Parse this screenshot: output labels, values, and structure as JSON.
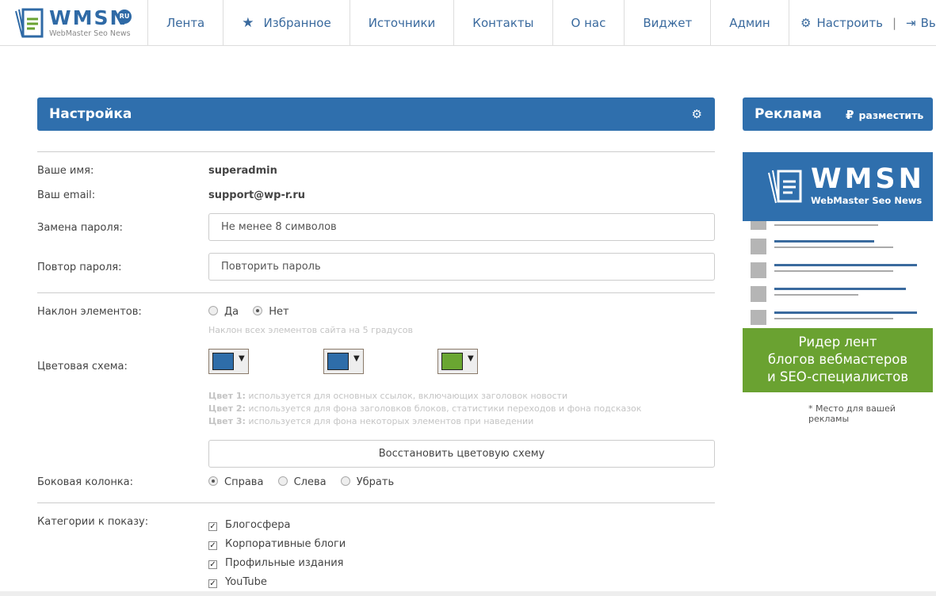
{
  "logo": {
    "text": "WMSN",
    "badge": "RU",
    "subtitle": "WebMaster Seo News"
  },
  "nav": [
    {
      "label": "Лента"
    },
    {
      "label": "Избранное",
      "icon": "star-icon"
    },
    {
      "label": "Источники"
    },
    {
      "label": "Контакты"
    },
    {
      "label": "О нас"
    },
    {
      "label": "Виджет"
    },
    {
      "label": "Админ"
    }
  ],
  "top_right": {
    "settings": "Настроить",
    "separator": "|",
    "logout": "Вы"
  },
  "settings": {
    "title": "Настройка",
    "name_label": "Ваше имя:",
    "name_value": "superadmin",
    "email_label": "Ваш email:",
    "email_value": "support@wp-r.ru",
    "password_label": "Замена пароля:",
    "password_placeholder": "Не менее 8 символов",
    "repeat_label": "Повтор пароля:",
    "repeat_placeholder": "Повторить пароль",
    "tilt_label": "Наклон элементов:",
    "tilt_yes": "Да",
    "tilt_no": "Нет",
    "tilt_selected": "Нет",
    "tilt_hint": "Наклон всех элементов сайта на 5 градусов",
    "color_label": "Цветовая схема:",
    "colors": [
      "#2e6da9",
      "#2e6da9",
      "#6aa631"
    ],
    "color_hints": [
      {
        "k": "Цвет 1:",
        "v": " используется для основных ссылок, включающих заголовок новости"
      },
      {
        "k": "Цвет 2:",
        "v": " используется для фона заголовков блоков, статистики переходов и фона подсказок"
      },
      {
        "k": "Цвет 3:",
        "v": " используется для фона некоторых элементов при наведении"
      }
    ],
    "restore_button": "Восстановить цветовую схему",
    "sidebar_label": "Боковая колонка:",
    "sidebar_options": [
      "Справа",
      "Слева",
      "Убрать"
    ],
    "sidebar_selected": "Справа",
    "categories_label": "Категории к показу:",
    "categories": [
      {
        "label": "Блогосфера",
        "checked": true
      },
      {
        "label": "Корпоративные блоги",
        "checked": true
      },
      {
        "label": "Профильные издания",
        "checked": true
      },
      {
        "label": "YouTube",
        "checked": true
      }
    ]
  },
  "ads": {
    "title": "Реклама",
    "place_button": "разместить",
    "banner_logo": "WMSN",
    "banner_sub": "WebMaster Seo News",
    "banner_text_1": "Ридер лент",
    "banner_text_2": "блогов вебмастеров",
    "banner_text_3": "и SEO-специалистов",
    "note": "* Место для вашей рекламы"
  }
}
